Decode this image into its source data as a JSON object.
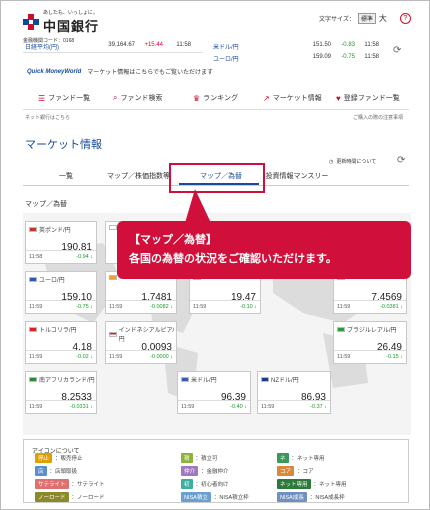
{
  "header": {
    "tagline": "あしたも、いっしょに。",
    "bank_name": "中国銀行",
    "bank_code": "金融機関コード：0168",
    "font_size_label": "文字サイズ：",
    "font_std": "標準",
    "font_large": "大",
    "help": "?"
  },
  "ticker": [
    {
      "name": "日経平均(円)",
      "value": "39,164.67",
      "change": "+15.44",
      "time": "11:58",
      "dir": "up"
    },
    {
      "name": "米ドル/円",
      "value": "151.50",
      "change": "-0.83",
      "time": "11:58",
      "dir": "down"
    },
    {
      "name": "ユーロ/円",
      "value": "159.09",
      "change": "-0.75",
      "time": "11:58",
      "dir": "down"
    }
  ],
  "quick": {
    "logo": "Quick MoneyWorld",
    "text": "マーケット情報はこちらでもご覧いただけます"
  },
  "nav": [
    {
      "icon": "☰",
      "label": "ファンド一覧"
    },
    {
      "icon": "⌕",
      "label": "ファンド検索"
    },
    {
      "icon": "♛",
      "label": "ランキング"
    },
    {
      "icon": "↗",
      "label": "マーケット情報"
    },
    {
      "icon": "♥",
      "label": "登録ファンド一覧"
    }
  ],
  "sub": {
    "left": "ネット銀行はこちら",
    "right": "ご購入の際の注意事項"
  },
  "page_title": "マーケット情報",
  "update_note": "更新時間について",
  "tabs": [
    "一覧",
    "マップ／株価指数等",
    "マップ／為替",
    "投資情報マンスリー"
  ],
  "section_title": "マップ／為替",
  "callout": {
    "title": "【マップ／為替】",
    "body": "各国の為替の状況をご確認いただけます。"
  },
  "cards": [
    {
      "name": "英ポンド/円",
      "value": "190.81",
      "time": "11:58",
      "change": "-0.94"
    },
    {
      "name": "",
      "value": "",
      "time": "",
      "change": ""
    },
    {
      "name": "ユーロ/円",
      "value": "159.10",
      "time": "11:59",
      "change": "-0.75"
    },
    {
      "name": "",
      "value": "1.7481",
      "time": "11:59",
      "change": "-0.0082"
    },
    {
      "name": "",
      "value": "19.47",
      "time": "11:59",
      "change": "-0.10"
    },
    {
      "name": "",
      "value": "7.4569",
      "time": "11:59",
      "change": "-0.0381"
    },
    {
      "name": "トルコリラ/円",
      "value": "4.18",
      "time": "11:59",
      "change": "-0.02"
    },
    {
      "name": "インドネシアルピア/円",
      "value": "0.0093",
      "time": "11:59",
      "change": "-0.0000"
    },
    {
      "name": "ブラジルレアル/円",
      "value": "26.49",
      "time": "11:59",
      "change": "-0.15"
    },
    {
      "name": "南アフリカランド/円",
      "value": "8.2533",
      "time": "11:59",
      "change": "-0.0331"
    },
    {
      "name": "米ドル/円",
      "value": "96.39",
      "time": "11:59",
      "change": "-0.40"
    },
    {
      "name": "NZドル/円",
      "value": "86.93",
      "time": "11:59",
      "change": "-0.37"
    }
  ],
  "legend": {
    "title": "アイコンについて",
    "items": [
      {
        "badge": "停止",
        "text": "：販売停止",
        "color": "#e0a000"
      },
      {
        "badge": "積",
        "text": "：積立可",
        "color": "#8db33a"
      },
      {
        "badge": "ネ",
        "text": "：ネット専用",
        "color": "#3a9a5a"
      },
      {
        "badge": "店",
        "text": "：店頭取扱",
        "color": "#5b8fd0"
      },
      {
        "badge": "仲介",
        "text": "：金融仲介",
        "color": "#a07ac0"
      },
      {
        "badge": "コア",
        "text": "：コア",
        "color": "#d88a3a"
      },
      {
        "badge": "サテライト",
        "text": "：サテライト",
        "color": "#e07070"
      },
      {
        "badge": "初",
        "text": "：初心者向け",
        "color": "#3cb0a0"
      },
      {
        "badge": "ネット専用",
        "text": "：ネット専用",
        "color": "#2a7a3a"
      },
      {
        "badge": "ノーロード",
        "text": "：ノーロード",
        "color": "#8a8a2a"
      },
      {
        "badge": "NISA積立",
        "text": "：NISA積立枠",
        "color": "#6aa0d0"
      },
      {
        "badge": "NISA成長",
        "text": "：NISA成長枠",
        "color": "#7090c0"
      }
    ]
  }
}
